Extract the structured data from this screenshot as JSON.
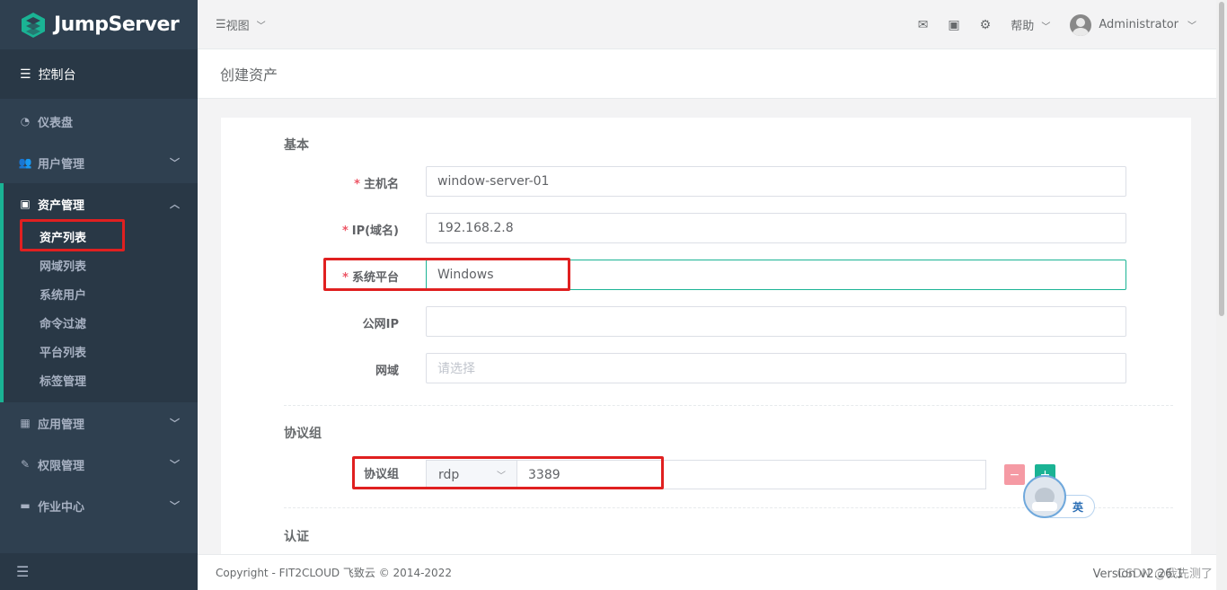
{
  "app": {
    "brand": "JumpServer",
    "console_label": "控制台"
  },
  "sidebar": {
    "items": [
      {
        "label": "仪表盘",
        "icon": "dashboard-icon"
      },
      {
        "label": "用户管理",
        "icon": "users-icon",
        "expandable": true
      },
      {
        "label": "资产管理",
        "icon": "inbox-icon",
        "expanded": true
      },
      {
        "label": "应用管理",
        "icon": "grid-icon",
        "expandable": true
      },
      {
        "label": "权限管理",
        "icon": "edit-icon",
        "expandable": true
      },
      {
        "label": "作业中心",
        "icon": "terminal-icon",
        "expandable": true
      }
    ],
    "asset_subitems": [
      "资产列表",
      "网域列表",
      "系统用户",
      "命令过滤",
      "平台列表",
      "标签管理"
    ],
    "current_subitem": "资产列表"
  },
  "topbar": {
    "view_label": "视图",
    "help_label": "帮助",
    "user_name": "Administrator"
  },
  "page": {
    "title": "创建资产"
  },
  "form": {
    "basic_section": "基本",
    "hostname_label": "主机名",
    "hostname_value": "window-server-01",
    "ip_label": "IP(域名)",
    "ip_value": "192.168.2.8",
    "platform_label": "系统平台",
    "platform_value": "Windows",
    "public_ip_label": "公网IP",
    "public_ip_value": "",
    "domain_label": "网域",
    "domain_placeholder": "请选择",
    "protocol_section": "协议组",
    "protocol_label": "协议组",
    "protocol_value": "rdp",
    "port_value": "3389",
    "minus_symbol": "−",
    "plus_symbol": "+",
    "auth_section": "认证"
  },
  "ime": {
    "mode": "英"
  },
  "footer": {
    "copyright": "Copyright - FIT2CLOUD 飞致云 © 2014-2022",
    "version": "Version v2.26.1",
    "watermark": "CSDN @我先测了"
  },
  "colors": {
    "sidebar_bg": "#2f4050",
    "accent": "#1ab394",
    "required": "#ed5565",
    "annotation_red": "#e02020"
  }
}
